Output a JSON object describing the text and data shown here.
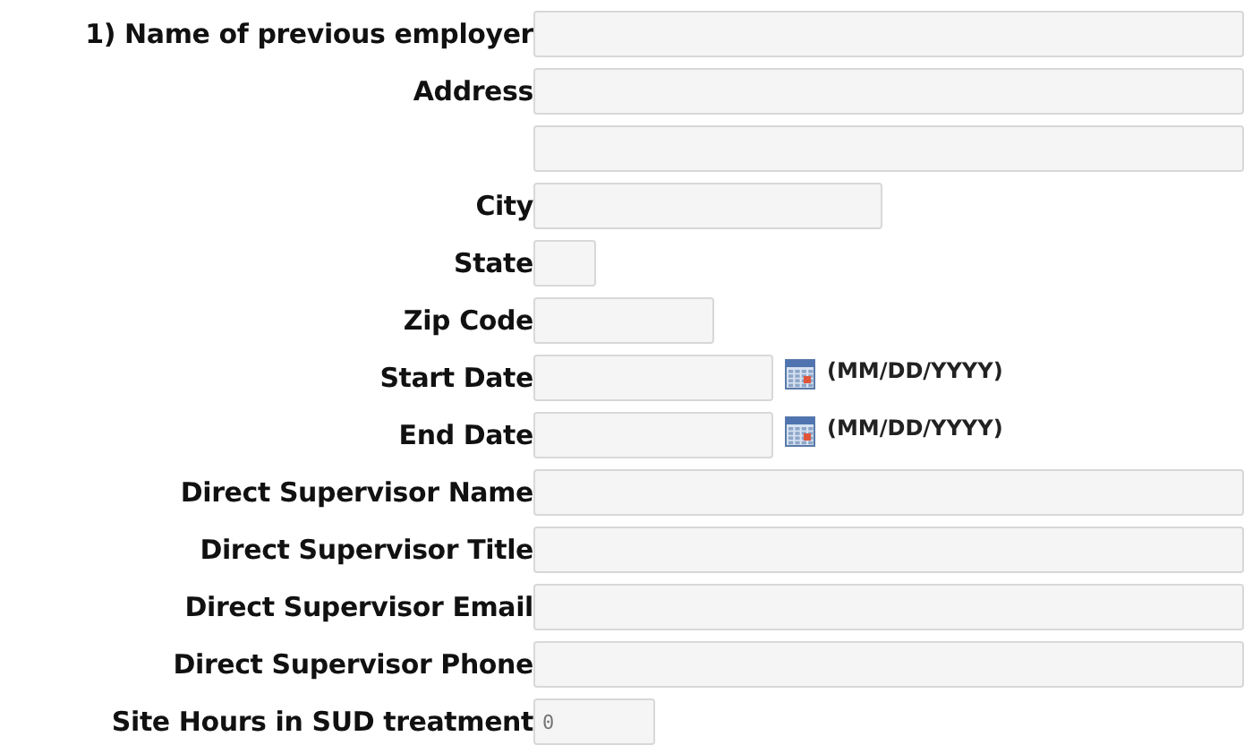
{
  "fields": [
    {
      "label": "1) Name of previous employer",
      "kind": "long"
    },
    {
      "label": "Address",
      "kind": "long"
    },
    {
      "kind": "long"
    },
    {
      "label": "City",
      "kind": "medium"
    },
    {
      "label": "State",
      "kind": "tiny"
    },
    {
      "label": "Zip Code",
      "kind": "short"
    },
    {
      "label": "Start Date",
      "kind": "date",
      "format": "(MM/DD/YYYY)"
    },
    {
      "label": "End Date",
      "kind": "date",
      "format": "(MM/DD/YYYY)"
    },
    {
      "label": "Direct Supervisor Name",
      "kind": "long"
    },
    {
      "label": "Direct Supervisor Title",
      "kind": "long"
    },
    {
      "label": "Direct Supervisor Email",
      "kind": "long"
    },
    {
      "label": "Direct Supervisor Phone",
      "kind": "long"
    },
    {
      "label": "Site Hours in SUD treatment",
      "kind": "number",
      "value": "0"
    }
  ]
}
